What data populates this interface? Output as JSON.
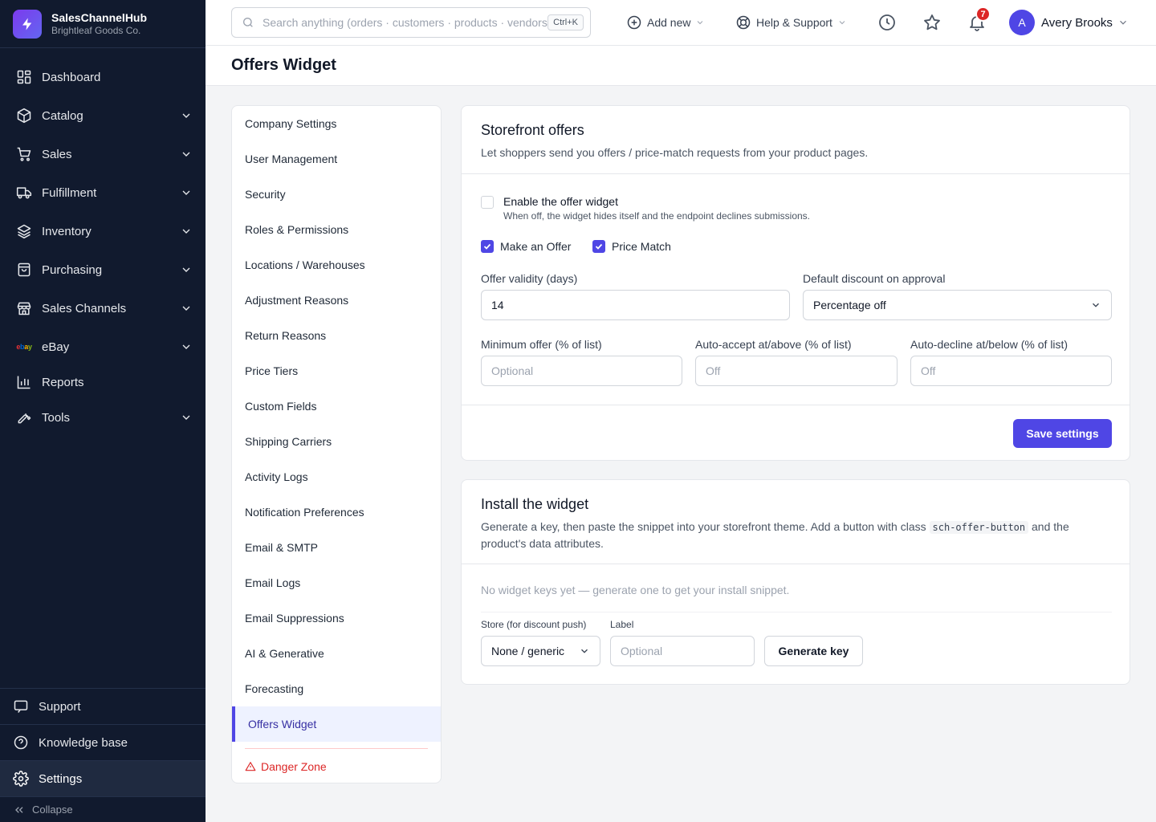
{
  "brand": {
    "name": "SalesChannelHub",
    "company": "Brightleaf Goods Co."
  },
  "sidebar": {
    "items": [
      {
        "label": "Dashboard"
      },
      {
        "label": "Catalog"
      },
      {
        "label": "Sales"
      },
      {
        "label": "Fulfillment"
      },
      {
        "label": "Inventory"
      },
      {
        "label": "Purchasing"
      },
      {
        "label": "Sales Channels"
      },
      {
        "label": "eBay"
      },
      {
        "label": "Reports"
      },
      {
        "label": "Tools"
      }
    ],
    "bottom": {
      "support": "Support",
      "knowledge": "Knowledge base",
      "settings": "Settings",
      "collapse": "Collapse"
    }
  },
  "topbar": {
    "search_placeholder": "Search anything (orders · customers · products · vendors)",
    "shortcut": "Ctrl+K",
    "add_new": "Add new",
    "help": "Help & Support",
    "notifications_count": "7",
    "user_initial": "A",
    "user_name": "Avery Brooks"
  },
  "page": {
    "title": "Offers Widget"
  },
  "settings_menu": {
    "items": [
      "Company Settings",
      "User Management",
      "Security",
      "Roles & Permissions",
      "Locations / Warehouses",
      "Adjustment Reasons",
      "Return Reasons",
      "Price Tiers",
      "Custom Fields",
      "Shipping Carriers",
      "Activity Logs",
      "Notification Preferences",
      "Email & SMTP",
      "Email Logs",
      "Email Suppressions",
      "AI & Generative",
      "Forecasting",
      "Offers Widget"
    ],
    "danger": "Danger Zone"
  },
  "storefront": {
    "title": "Storefront offers",
    "description": "Let shoppers send you offers / price-match requests from your product pages.",
    "enable_label": "Enable the offer widget",
    "enable_help": "When off, the widget hides itself and the endpoint declines submissions.",
    "make_offer_label": "Make an Offer",
    "price_match_label": "Price Match",
    "validity_label": "Offer validity (days)",
    "validity_value": "14",
    "discount_label": "Default discount on approval",
    "discount_value": "Percentage off",
    "min_offer_label": "Minimum offer (% of list)",
    "min_offer_placeholder": "Optional",
    "auto_accept_label": "Auto-accept at/above (% of list)",
    "auto_accept_placeholder": "Off",
    "auto_decline_label": "Auto-decline at/below (% of list)",
    "auto_decline_placeholder": "Off",
    "save_label": "Save settings"
  },
  "install": {
    "title": "Install the widget",
    "desc_before": "Generate a key, then paste the snippet into your storefront theme. Add a button with class ",
    "desc_code": "sch-offer-button",
    "desc_after": " and the product's data attributes.",
    "empty": "No widget keys yet — generate one to get your install snippet.",
    "store_label": "Store (for discount push)",
    "store_value": "None / generic",
    "label_label": "Label",
    "label_placeholder": "Optional",
    "generate_label": "Generate key"
  }
}
